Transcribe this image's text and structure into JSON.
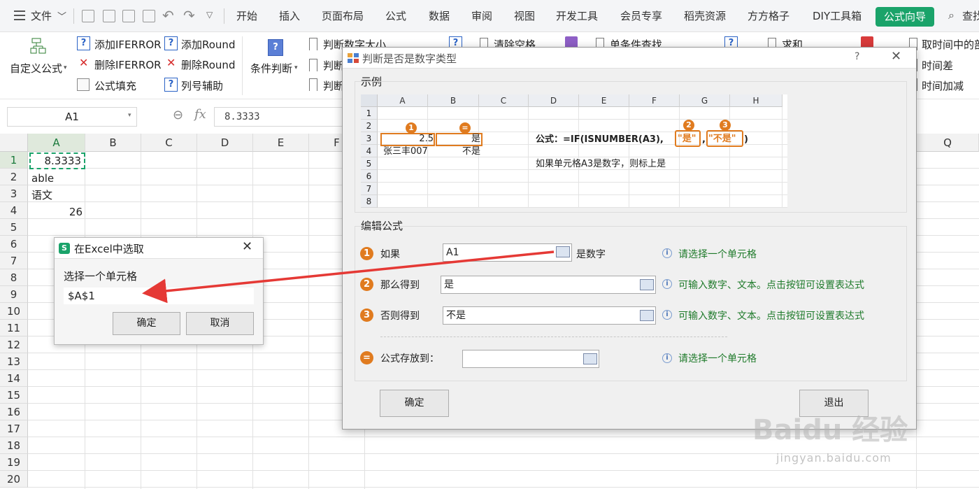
{
  "menu": {
    "file_label": "文件",
    "tabs": [
      "开始",
      "插入",
      "页面布局",
      "公式",
      "数据",
      "审阅",
      "视图",
      "开发工具",
      "会员专享",
      "稻壳资源",
      "方方格子",
      "DIY工具箱"
    ],
    "active_tab": "公式向导",
    "search_label": "查找"
  },
  "ribbon": {
    "custom_formula": "自定义公式",
    "add_iferror": "添加IFERROR",
    "del_iferror": "删除IFERROR",
    "formula_fill": "公式填充",
    "add_round": "添加Round",
    "del_round": "删除Round",
    "col_helper": "列号辅助",
    "condition": "条件判断",
    "judge1": "判断数字大小",
    "judge2": "判断",
    "judge3": "判断",
    "clear_space": "清除空格",
    "single_lookup": "单条件查找",
    "sum": "求和",
    "time_mid": "取时间中的部",
    "time_diff": "时间差",
    "time_add": "时间加减"
  },
  "formula_bar": {
    "name_box": "A1",
    "fx": "fx",
    "value": "8.3333"
  },
  "sheet": {
    "columns": [
      "A",
      "B",
      "C",
      "D",
      "E",
      "F",
      "Q"
    ],
    "rows": [
      "1",
      "2",
      "3",
      "4",
      "5",
      "6",
      "7",
      "8",
      "9",
      "10",
      "11",
      "12",
      "13",
      "14",
      "15",
      "16",
      "17",
      "18",
      "19",
      "20"
    ],
    "cells": {
      "a1": "8.3333",
      "a2": "able",
      "a3": "语文",
      "a4": "26"
    }
  },
  "pick_dialog": {
    "title": "在Excel中选取",
    "label": "选择一个单元格",
    "value": "$A$1",
    "ok": "确定",
    "cancel": "取消"
  },
  "main_dialog": {
    "title": "判断是否是数字类型",
    "help": "?",
    "example_label": "示例",
    "mini_columns": [
      "A",
      "B",
      "C",
      "D",
      "E",
      "F",
      "G",
      "H"
    ],
    "mini_rows": [
      "1",
      "2",
      "3",
      "4",
      "5",
      "6",
      "7",
      "8"
    ],
    "mini_cells": {
      "a3": "2.5",
      "b3": "是",
      "a4": "张三丰007",
      "b4": "不是"
    },
    "badges": [
      "1",
      "=",
      "2",
      "3"
    ],
    "formula_prefix": "公式：=IF(ISNUMBER(A3),",
    "formula_arg2": "\"是\"",
    "formula_comma": ",",
    "formula_arg3": "\"不是\"",
    "formula_suffix": ")",
    "explain": "如果单元格A3是数字，则标上是",
    "edit_label": "编辑公式",
    "steps": {
      "if": {
        "num": "1",
        "label": "如果",
        "value": "A1",
        "suffix": "是数字",
        "hint": "请选择一个单元格"
      },
      "then": {
        "num": "2",
        "label": "那么得到",
        "value": "是",
        "hint": "可输入数字、文本。点击按钮可设置表达式"
      },
      "else": {
        "num": "3",
        "label": "否则得到",
        "value": "不是",
        "hint": "可输入数字、文本。点击按钮可设置表达式"
      },
      "store": {
        "num": "=",
        "label": "公式存放到：",
        "value": "",
        "hint": "请选择一个单元格"
      }
    },
    "ok": "确定",
    "exit": "退出"
  },
  "watermark": {
    "brand": "Baidu 经验",
    "url": "jingyan.baidu.com"
  },
  "colors": {
    "accent": "#1aa36a",
    "orange": "#e07b1f",
    "arrow": "#e53935",
    "hint_green": "#1e7a2a"
  }
}
